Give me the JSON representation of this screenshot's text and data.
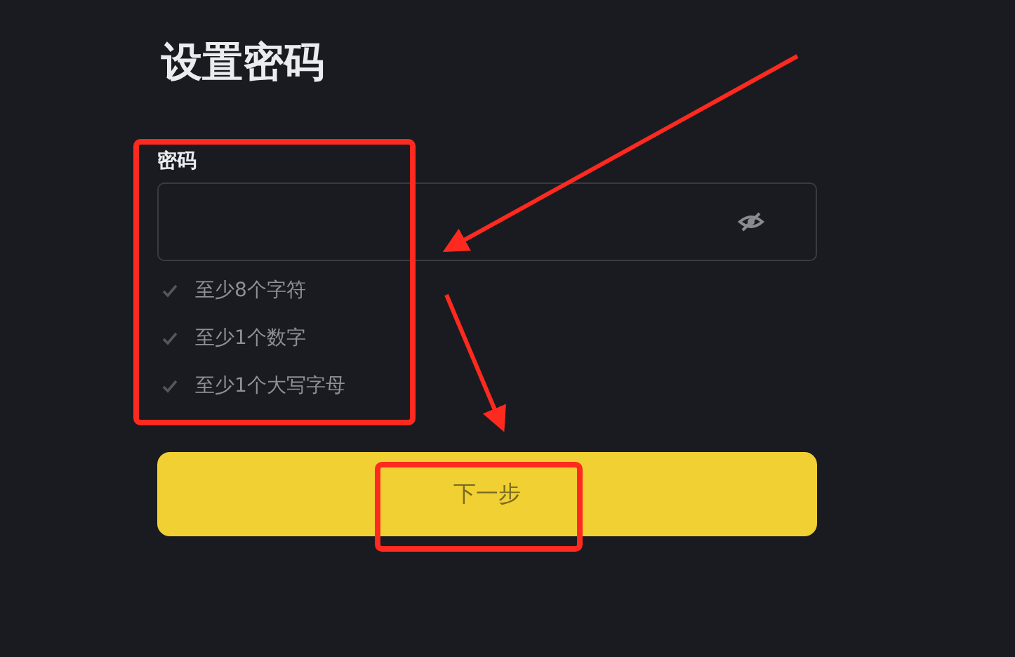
{
  "title": "设置密码",
  "password": {
    "label": "密码",
    "visible": false
  },
  "rules": [
    {
      "text": "至少8个字符",
      "checked": false
    },
    {
      "text": "至少1个数字",
      "checked": false
    },
    {
      "text": "至少1个大写字母",
      "checked": false
    }
  ],
  "next_button": {
    "label": "下一步",
    "disabled": true
  }
}
